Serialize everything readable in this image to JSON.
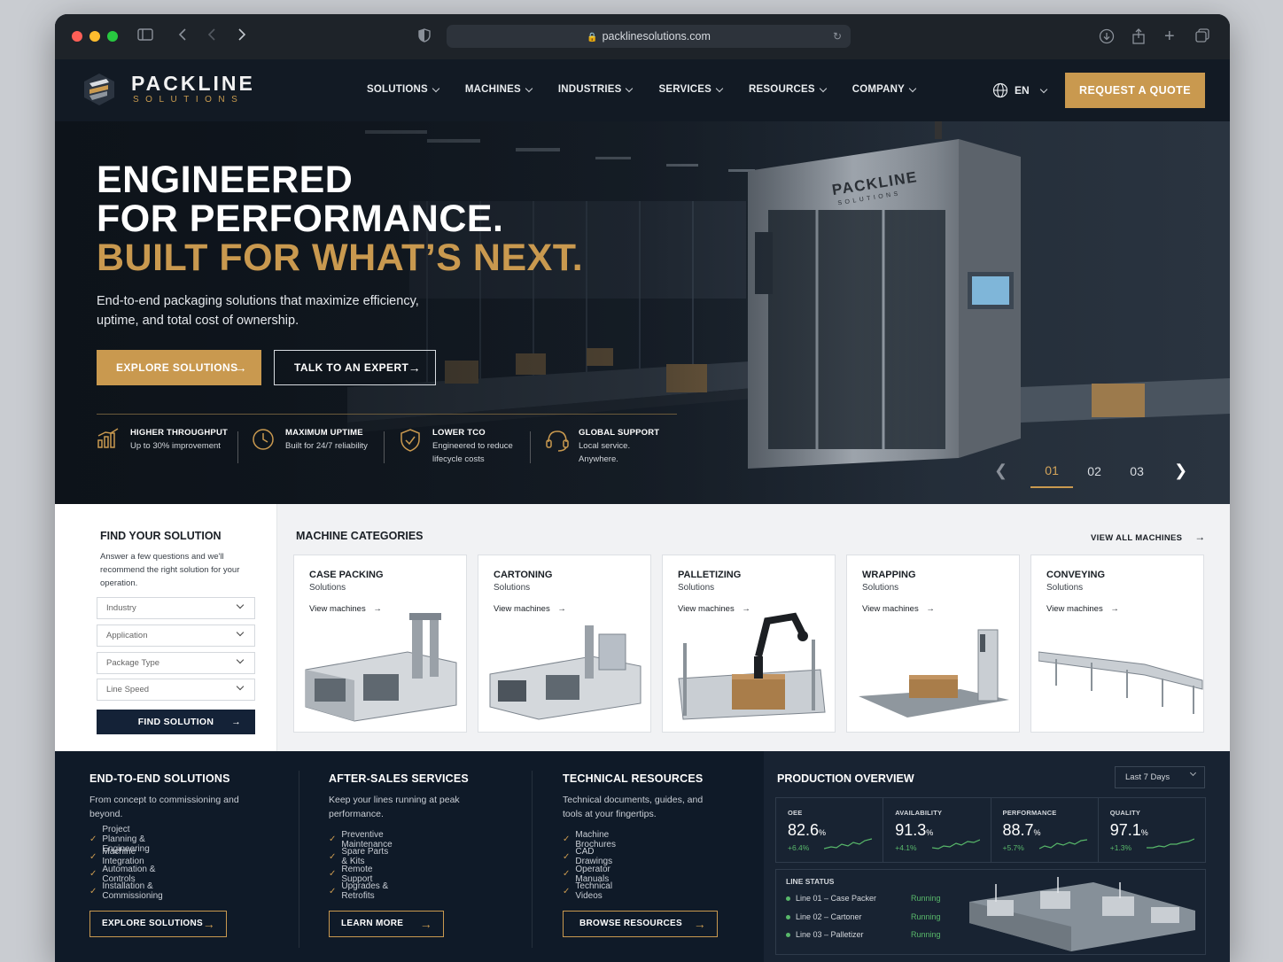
{
  "browser": {
    "url": "packlinesolutions.com"
  },
  "brand": {
    "name": "PACKLINE",
    "tagline": "SOLUTIONS",
    "accent": "#c9994f",
    "navy": "#121a24"
  },
  "nav": {
    "items": [
      "SOLUTIONS",
      "MACHINES",
      "INDUSTRIES",
      "SERVICES",
      "RESOURCES",
      "COMPANY"
    ],
    "lang": "EN",
    "cta": "REQUEST A QUOTE"
  },
  "hero": {
    "line1": "ENGINEERED",
    "line2": "FOR PERFORMANCE.",
    "line3": "BUILT FOR WHAT’S NEXT.",
    "sub": "End-to-end packaging solutions that maximize efficiency, uptime, and total cost of ownership.",
    "primary_cta": "EXPLORE SOLUTIONS",
    "secondary_cta": "TALK TO AN EXPERT",
    "machine_brand": "PACKLINE",
    "machine_tagline": "SOLUTIONS",
    "features": [
      {
        "title": "HIGHER THROUGHPUT",
        "desc": "Up to 30% improvement",
        "icon": "bar-chart-icon"
      },
      {
        "title": "MAXIMUM UPTIME",
        "desc": "Built for 24/7 reliability",
        "icon": "clock-icon"
      },
      {
        "title": "LOWER TCO",
        "desc": "Engineered to reduce lifecycle costs",
        "icon": "shield-check-icon"
      },
      {
        "title": "GLOBAL SUPPORT",
        "desc": "Local service. Anywhere.",
        "icon": "headset-icon"
      }
    ],
    "slides": [
      "01",
      "02",
      "03"
    ],
    "active_slide": "01"
  },
  "finder": {
    "title": "FIND YOUR SOLUTION",
    "desc": "Answer a few questions and we'll recommend the right solution for your operation.",
    "fields": [
      "Industry",
      "Application",
      "Package Type",
      "Line Speed"
    ],
    "button": "FIND SOLUTION"
  },
  "categories": {
    "title": "MACHINE CATEGORIES",
    "view_all": "VIEW ALL MACHINES",
    "items": [
      {
        "name": "CASE PACKING",
        "sub": "Solutions",
        "link": "View machines"
      },
      {
        "name": "CARTONING",
        "sub": "Solutions",
        "link": "View machines"
      },
      {
        "name": "PALLETIZING",
        "sub": "Solutions",
        "link": "View machines"
      },
      {
        "name": "WRAPPING",
        "sub": "Solutions",
        "link": "View machines"
      },
      {
        "name": "CONVEYING",
        "sub": "Solutions",
        "link": "View machines"
      }
    ]
  },
  "columns": [
    {
      "title": "END-TO-END SOLUTIONS",
      "desc": "From concept to commissioning and beyond.",
      "items": [
        "Project Planning & Engineering",
        "Machine Integration",
        "Automation & Controls",
        "Installation & Commissioning"
      ],
      "button": "EXPLORE SOLUTIONS"
    },
    {
      "title": "AFTER-SALES SERVICES",
      "desc": "Keep your lines running at peak performance.",
      "items": [
        "Preventive Maintenance",
        "Spare Parts & Kits",
        "Remote Support",
        "Upgrades & Retrofits"
      ],
      "button": "LEARN MORE"
    },
    {
      "title": "TECHNICAL RESOURCES",
      "desc": "Technical documents, guides, and tools at your fingertips.",
      "items": [
        "Machine Brochures",
        "CAD Drawings",
        "Operator Manuals",
        "Technical Videos"
      ],
      "button": "BROWSE RESOURCES"
    }
  ],
  "production": {
    "title": "PRODUCTION OVERVIEW",
    "range": "Last 7 Days",
    "kpis": [
      {
        "label": "OEE",
        "value": "82.6",
        "unit": "%",
        "delta": "+6.4%"
      },
      {
        "label": "AVAILABILITY",
        "value": "91.3",
        "unit": "%",
        "delta": "+4.1%"
      },
      {
        "label": "PERFORMANCE",
        "value": "88.7",
        "unit": "%",
        "delta": "+5.7%"
      },
      {
        "label": "QUALITY",
        "value": "97.1",
        "unit": "%",
        "delta": "+1.3%"
      }
    ],
    "line_status_title": "LINE STATUS",
    "lines": [
      {
        "name": "Line 01 – Case Packer",
        "status": "Running"
      },
      {
        "name": "Line 02 – Cartoner",
        "status": "Running"
      },
      {
        "name": "Line 03 – Palletizer",
        "status": "Running"
      }
    ]
  }
}
